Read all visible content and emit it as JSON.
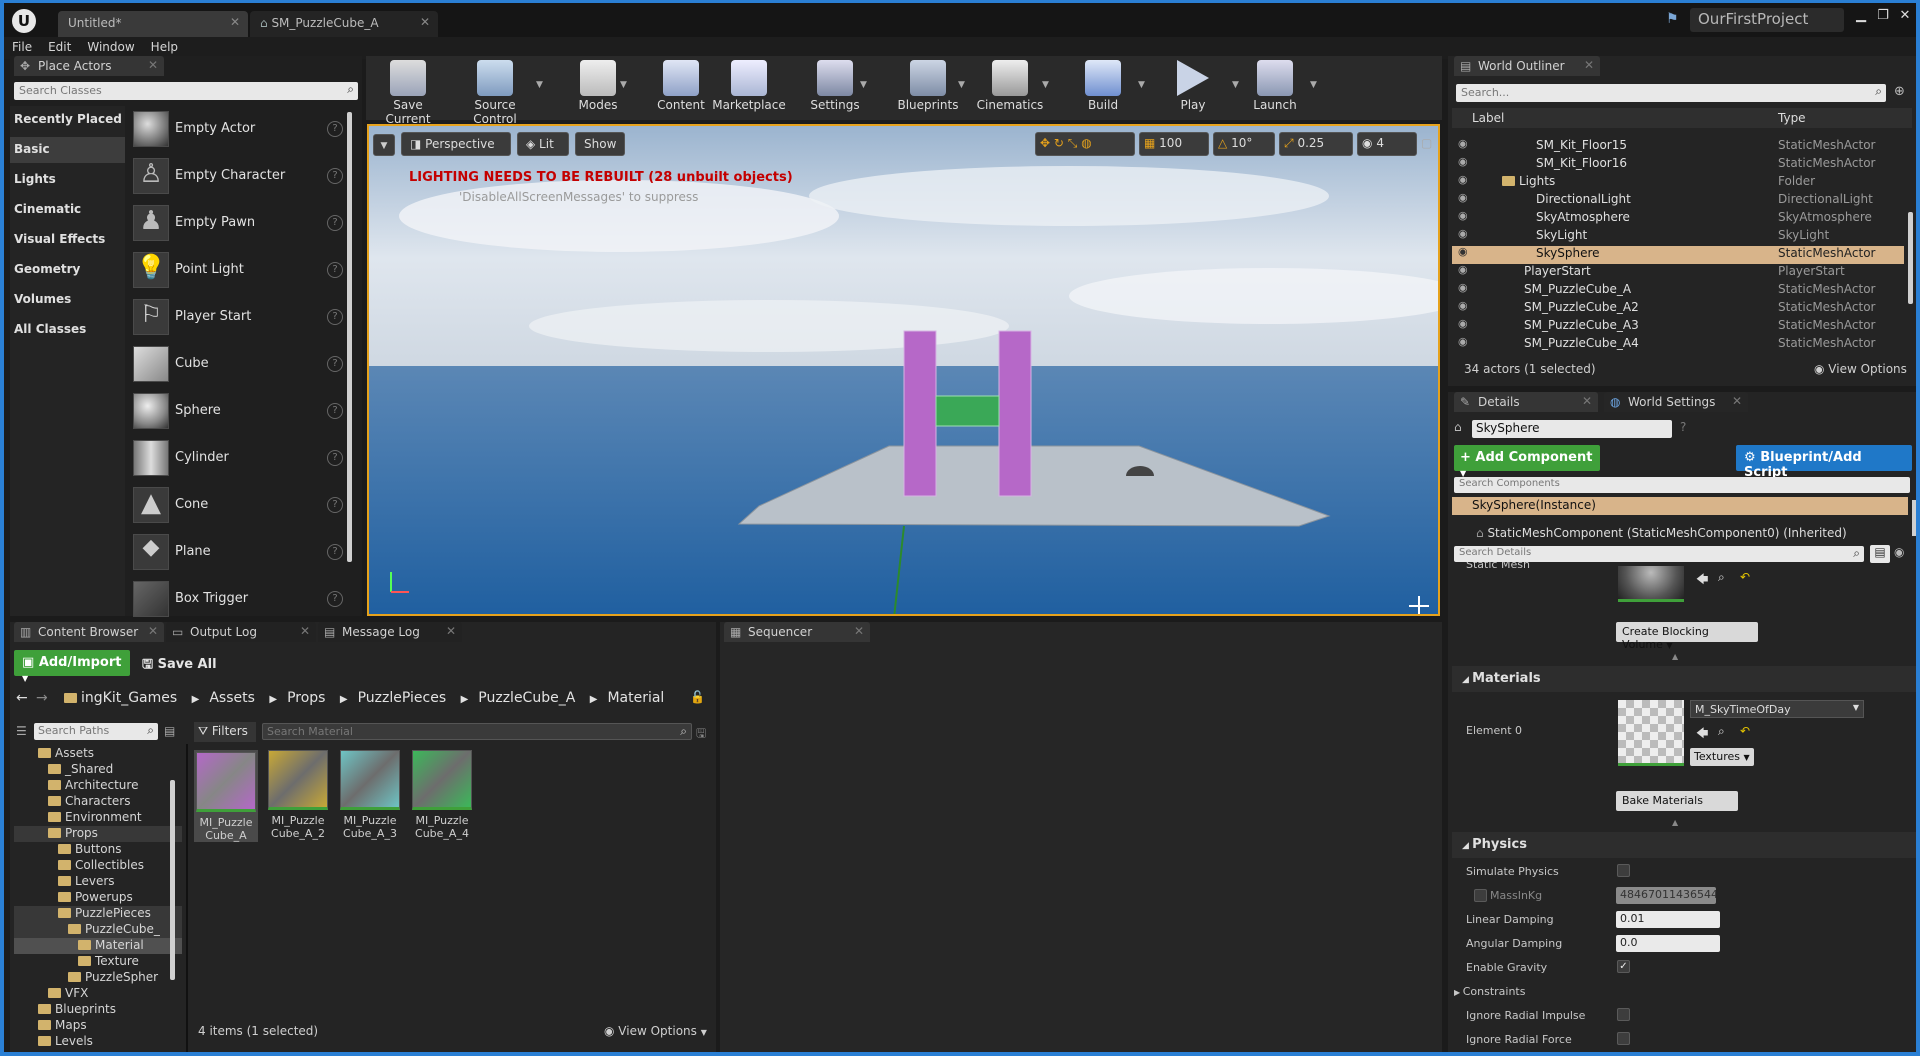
{
  "title_tabs": [
    {
      "label": "Untitled*"
    },
    {
      "label": "SM_PuzzleCube_A"
    }
  ],
  "project_name": "OurFirstProject",
  "menu": [
    "File",
    "Edit",
    "Window",
    "Help"
  ],
  "place_actors": {
    "tab": "Place Actors",
    "search_placeholder": "Search Classes",
    "categories": [
      "Recently Placed",
      "Basic",
      "Lights",
      "Cinematic",
      "Visual Effects",
      "Geometry",
      "Volumes",
      "All Classes"
    ],
    "selected_category": "Basic",
    "items": [
      "Empty Actor",
      "Empty Character",
      "Empty Pawn",
      "Point Light",
      "Player Start",
      "Cube",
      "Sphere",
      "Cylinder",
      "Cone",
      "Plane",
      "Box Trigger"
    ]
  },
  "toolbar": [
    {
      "label": "Save Current",
      "icon": "save-icon"
    },
    {
      "label": "Source Control",
      "icon": "source-control-icon"
    },
    {
      "label": "Modes",
      "icon": "modes-icon"
    },
    {
      "label": "Content",
      "icon": "content-icon"
    },
    {
      "label": "Marketplace",
      "icon": "marketplace-icon"
    },
    {
      "label": "Settings",
      "icon": "settings-icon"
    },
    {
      "label": "Blueprints",
      "icon": "blueprints-icon"
    },
    {
      "label": "Cinematics",
      "icon": "cinematics-icon"
    },
    {
      "label": "Build",
      "icon": "build-icon"
    },
    {
      "label": "Play",
      "icon": "play-icon"
    },
    {
      "label": "Launch",
      "icon": "launch-icon"
    }
  ],
  "viewport": {
    "perspective": "Perspective",
    "lit": "Lit",
    "show": "Show",
    "grid_snap": "100",
    "rot_snap": "10°",
    "scale_snap": "0.25",
    "cam_speed": "4",
    "warning": "LIGHTING NEEDS TO BE REBUILT (28 unbuilt objects)",
    "warning_sub": "'DisableAllScreenMessages' to suppress"
  },
  "outliner": {
    "tab": "World Outliner",
    "search_placeholder": "Search...",
    "col_label": "Label",
    "col_type": "Type",
    "rows": [
      {
        "label": "SM_Kit_Floor15",
        "type": "StaticMeshActor",
        "indent": 2
      },
      {
        "label": "SM_Kit_Floor16",
        "type": "StaticMeshActor",
        "indent": 2
      },
      {
        "label": "Lights",
        "type": "Folder",
        "indent": 1
      },
      {
        "label": "DirectionalLight",
        "type": "DirectionalLight",
        "indent": 2
      },
      {
        "label": "SkyAtmosphere",
        "type": "SkyAtmosphere",
        "indent": 2
      },
      {
        "label": "SkyLight",
        "type": "SkyLight",
        "indent": 2
      },
      {
        "label": "SkySphere",
        "type": "StaticMeshActor",
        "indent": 2,
        "selected": true
      },
      {
        "label": "PlayerStart",
        "type": "PlayerStart",
        "indent": 1
      },
      {
        "label": "SM_PuzzleCube_A",
        "type": "StaticMeshActor",
        "indent": 1
      },
      {
        "label": "SM_PuzzleCube_A2",
        "type": "StaticMeshActor",
        "indent": 1
      },
      {
        "label": "SM_PuzzleCube_A3",
        "type": "StaticMeshActor",
        "indent": 1
      },
      {
        "label": "SM_PuzzleCube_A4",
        "type": "StaticMeshActor",
        "indent": 1
      }
    ],
    "status": "34 actors (1 selected)",
    "view_options": "View Options"
  },
  "details": {
    "tab_details": "Details",
    "tab_world": "World Settings",
    "name_value": "SkySphere",
    "add_component": "+ Add Component",
    "blueprint": "Blueprint/Add Script",
    "search_components": "Search Components",
    "instance_row": "SkySphere(Instance)",
    "component_row": "StaticMeshComponent (StaticMeshComponent0) (Inherited)",
    "search_details": "Search Details",
    "static_mesh_label": "Static Mesh",
    "create_blocking": "Create Blocking Volume",
    "materials_header": "Materials",
    "element0": "Element 0",
    "material_name": "M_SkyTimeOfDay",
    "textures": "Textures",
    "bake_materials": "Bake Materials",
    "physics_header": "Physics",
    "simulate_physics": "Simulate Physics",
    "mass_label": "MassInKg",
    "mass_value": "48467011436544.0",
    "linear_damping": "Linear Damping",
    "linear_value": "0.01",
    "angular_damping": "Angular Damping",
    "angular_value": "0.0",
    "enable_gravity": "Enable Gravity",
    "constraints": "Constraints",
    "ignore_impulse": "Ignore Radial Impulse",
    "ignore_force": "Ignore Radial Force"
  },
  "content_browser": {
    "tabs": [
      "Content Browser",
      "Output Log",
      "Message Log"
    ],
    "add_import": "Add/Import",
    "save_all": "Save All",
    "breadcrumb": [
      "ingKit_Games",
      "Assets",
      "Props",
      "PuzzlePieces",
      "PuzzleCube_A",
      "Material"
    ],
    "search_paths": "Search Paths",
    "filters": "Filters",
    "search_material": "Search Material",
    "tree": [
      {
        "label": "Assets",
        "indent": 0
      },
      {
        "label": "_Shared",
        "indent": 1
      },
      {
        "label": "Architecture",
        "indent": 1
      },
      {
        "label": "Characters",
        "indent": 1
      },
      {
        "label": "Environment",
        "indent": 1
      },
      {
        "label": "Props",
        "indent": 1,
        "hl": true
      },
      {
        "label": "Buttons",
        "indent": 2
      },
      {
        "label": "Collectibles",
        "indent": 2
      },
      {
        "label": "Levers",
        "indent": 2
      },
      {
        "label": "Powerups",
        "indent": 2
      },
      {
        "label": "PuzzlePieces",
        "indent": 2,
        "hl": true
      },
      {
        "label": "PuzzleCube_",
        "indent": 3,
        "hl": true
      },
      {
        "label": "Material",
        "indent": 4,
        "sel": true
      },
      {
        "label": "Texture",
        "indent": 4
      },
      {
        "label": "PuzzleSpher",
        "indent": 3
      },
      {
        "label": "VFX",
        "indent": 1
      },
      {
        "label": "Blueprints",
        "indent": 0
      },
      {
        "label": "Maps",
        "indent": 0
      },
      {
        "label": "Levels",
        "indent": 0
      }
    ],
    "assets": [
      {
        "name": "MI_Puzzle Cube_A",
        "color": "#b468c8"
      },
      {
        "name": "MI_Puzzle Cube_A_2",
        "color": "#c8a836"
      },
      {
        "name": "MI_Puzzle Cube_A_3",
        "color": "#6ec4c4"
      },
      {
        "name": "MI_Puzzle Cube_A_4",
        "color": "#3cb85a"
      }
    ],
    "status": "4 items (1 selected)",
    "view_options": "View Options"
  },
  "sequencer": {
    "tab": "Sequencer"
  },
  "colors": {
    "accent": "#2a7fd4",
    "viewport_border": "#e6a21c",
    "green_button": "#3fa03a",
    "selected_row": "#d8b48a",
    "warning_red": "#c40000"
  }
}
